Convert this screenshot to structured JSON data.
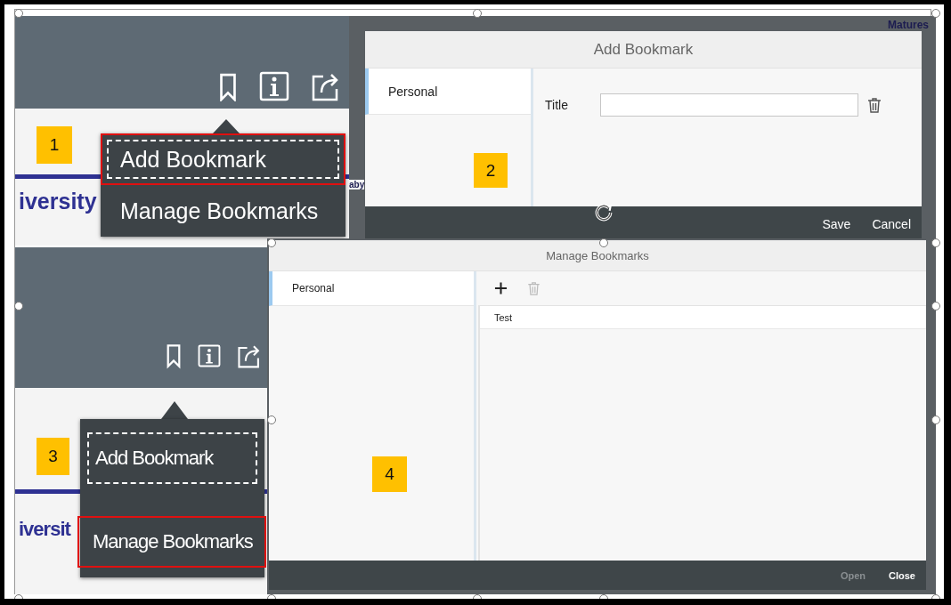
{
  "screens": [
    {
      "kind": "menu",
      "badge": "1",
      "backdrop_text": "iversity",
      "menu_items": [
        {
          "label": "Add Bookmark",
          "focused": true,
          "highlighted": true
        },
        {
          "label": "Manage Bookmarks",
          "focused": false,
          "highlighted": false
        }
      ]
    },
    {
      "kind": "add_dialog",
      "badge": "2",
      "backdrop_texts": [
        "Matures",
        "aby"
      ],
      "title": "Add Bookmark",
      "folders": [
        {
          "label": "Personal",
          "selected": true
        }
      ],
      "field_label": "Title",
      "buttons": [
        {
          "label": "Save",
          "disabled": false
        },
        {
          "label": "Cancel",
          "disabled": false
        }
      ]
    },
    {
      "kind": "menu",
      "badge": "3",
      "backdrop_text": "iversit",
      "menu_items": [
        {
          "label": "Add Bookmark",
          "focused": true,
          "highlighted": false
        },
        {
          "label": "Manage Bookmarks",
          "focused": false,
          "highlighted": true
        }
      ]
    },
    {
      "kind": "manage_dialog",
      "badge": "4",
      "title": "Manage Bookmarks",
      "folders": [
        {
          "label": "Personal",
          "selected": true
        }
      ],
      "tools": [
        {
          "kind": "add",
          "disabled": false
        },
        {
          "kind": "delete",
          "disabled": true
        }
      ],
      "bookmarks": [
        {
          "label": "Test"
        }
      ],
      "buttons": [
        {
          "label": "Open",
          "disabled": true
        },
        {
          "label": "Close",
          "disabled": false
        }
      ]
    }
  ]
}
